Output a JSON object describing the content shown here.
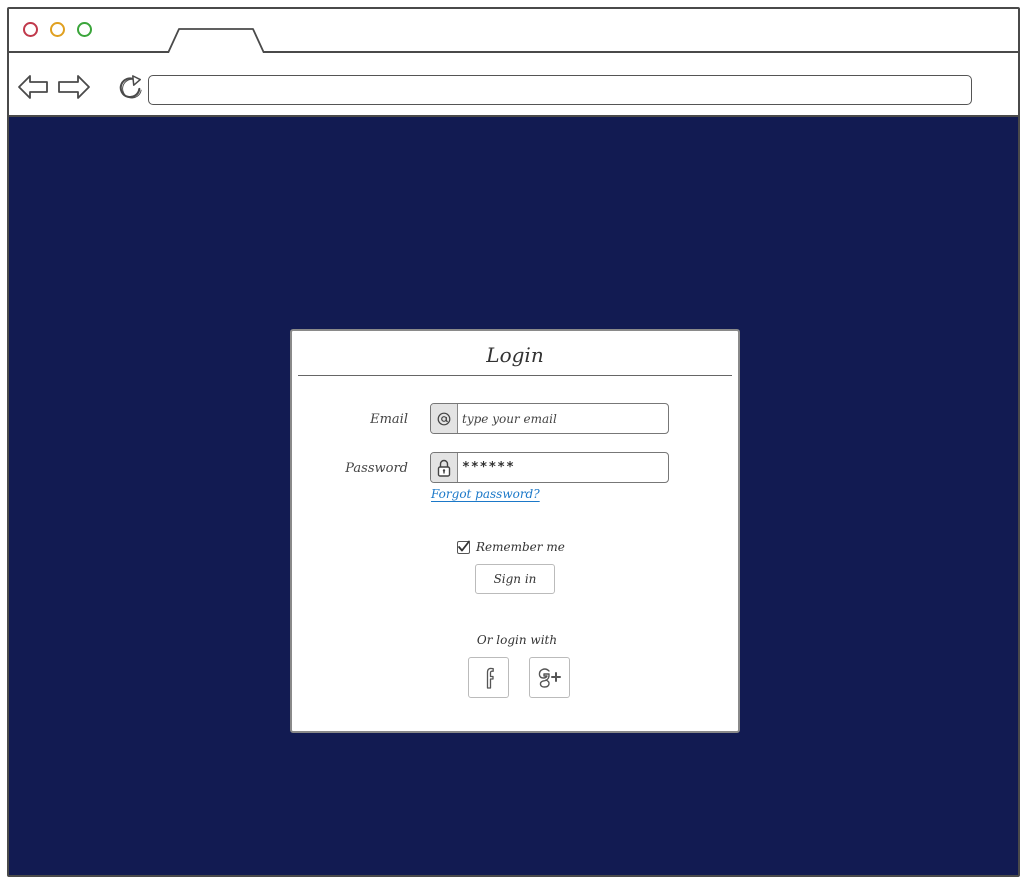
{
  "colors": {
    "viewport_bg": "#121b52",
    "card_bg": "#ffffff",
    "link": "#1b78c8",
    "window_dot_red": "#c0394b",
    "window_dot_yellow": "#e0a020",
    "window_dot_green": "#3aa53a"
  },
  "browser": {
    "tab_label": "",
    "url": "",
    "icons": {
      "back": "arrow-left-icon",
      "forward": "arrow-right-icon",
      "reload": "reload-icon"
    }
  },
  "login": {
    "title": "Login",
    "email": {
      "label": "Email",
      "icon": "at-sign-icon",
      "placeholder": "type your email"
    },
    "password": {
      "label": "Password",
      "icon": "lock-icon",
      "value": "******"
    },
    "forgot_password": "Forgot password?",
    "remember_me": {
      "label": "Remember me",
      "checked": true
    },
    "sign_in": "Sign in",
    "or_login_with": "Or login with",
    "social": [
      {
        "name": "facebook",
        "glyph": "f",
        "icon": "facebook-icon"
      },
      {
        "name": "google-plus",
        "glyph": "g+",
        "icon": "google-plus-icon"
      }
    ]
  }
}
